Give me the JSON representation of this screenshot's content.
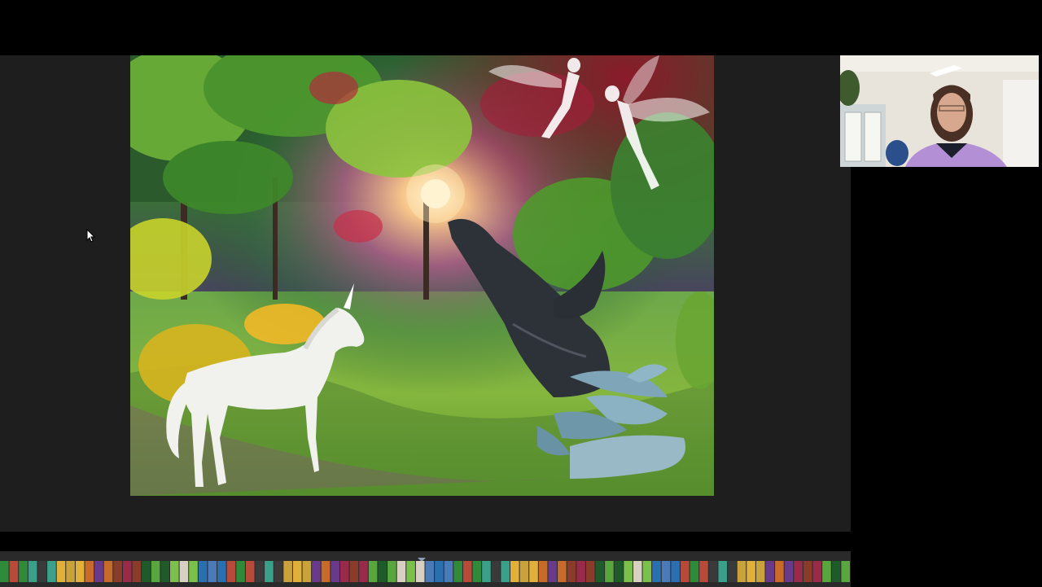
{
  "screen": {
    "background": "#000000",
    "stage_background": "#1e1e1e",
    "filmstrip_background": "#2a2a2a"
  },
  "slide": {
    "subject": "fantasy-forest-scene",
    "elements": [
      "unicorn",
      "whale",
      "dolphins",
      "fairies",
      "sun",
      "autumn-leaves"
    ]
  },
  "video": {
    "participant": "presenter",
    "icon": "person-video"
  },
  "filmstrip": {
    "thumbnail_count": 90,
    "toggle_icon": "chevron-down-icon"
  },
  "cursor": {
    "icon": "pointer-cursor-icon"
  }
}
